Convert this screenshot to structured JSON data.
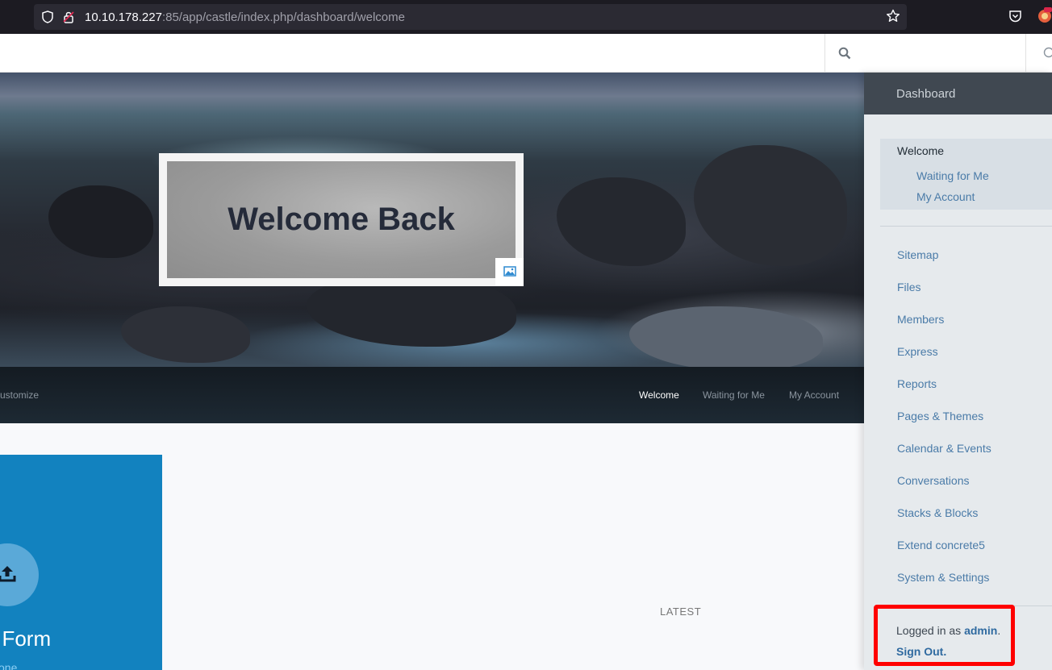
{
  "browser": {
    "url_host": "10.10.178.227",
    "url_rest": ":85/app/castle/index.php/dashboard/welcome"
  },
  "hero": {
    "title": "Welcome Back"
  },
  "nav": {
    "customize_label": "ustomize",
    "items": [
      {
        "label": "Welcome",
        "active": true
      },
      {
        "label": "Waiting for Me",
        "active": false
      },
      {
        "label": "My Account",
        "active": false
      }
    ]
  },
  "content": {
    "tile_title": "t Form",
    "tile_sub": "one",
    "latest_label": "LATEST"
  },
  "dashboard": {
    "title": "Dashboard",
    "welcome": "Welcome",
    "sub_items": [
      "Waiting for Me",
      "My Account"
    ],
    "links": [
      "Sitemap",
      "Files",
      "Members",
      "Express",
      "Reports",
      "Pages & Themes",
      "Calendar & Events",
      "Conversations",
      "Stacks & Blocks",
      "Extend concrete5",
      "System & Settings"
    ],
    "logged_in_prefix": "Logged in as",
    "username": "admin",
    "logged_in_suffix": ".",
    "sign_out": "Sign Out."
  },
  "colors": {
    "accent_blue": "#1282bf",
    "link_blue": "#4a7ba8",
    "highlight_red": "#ff0000"
  }
}
